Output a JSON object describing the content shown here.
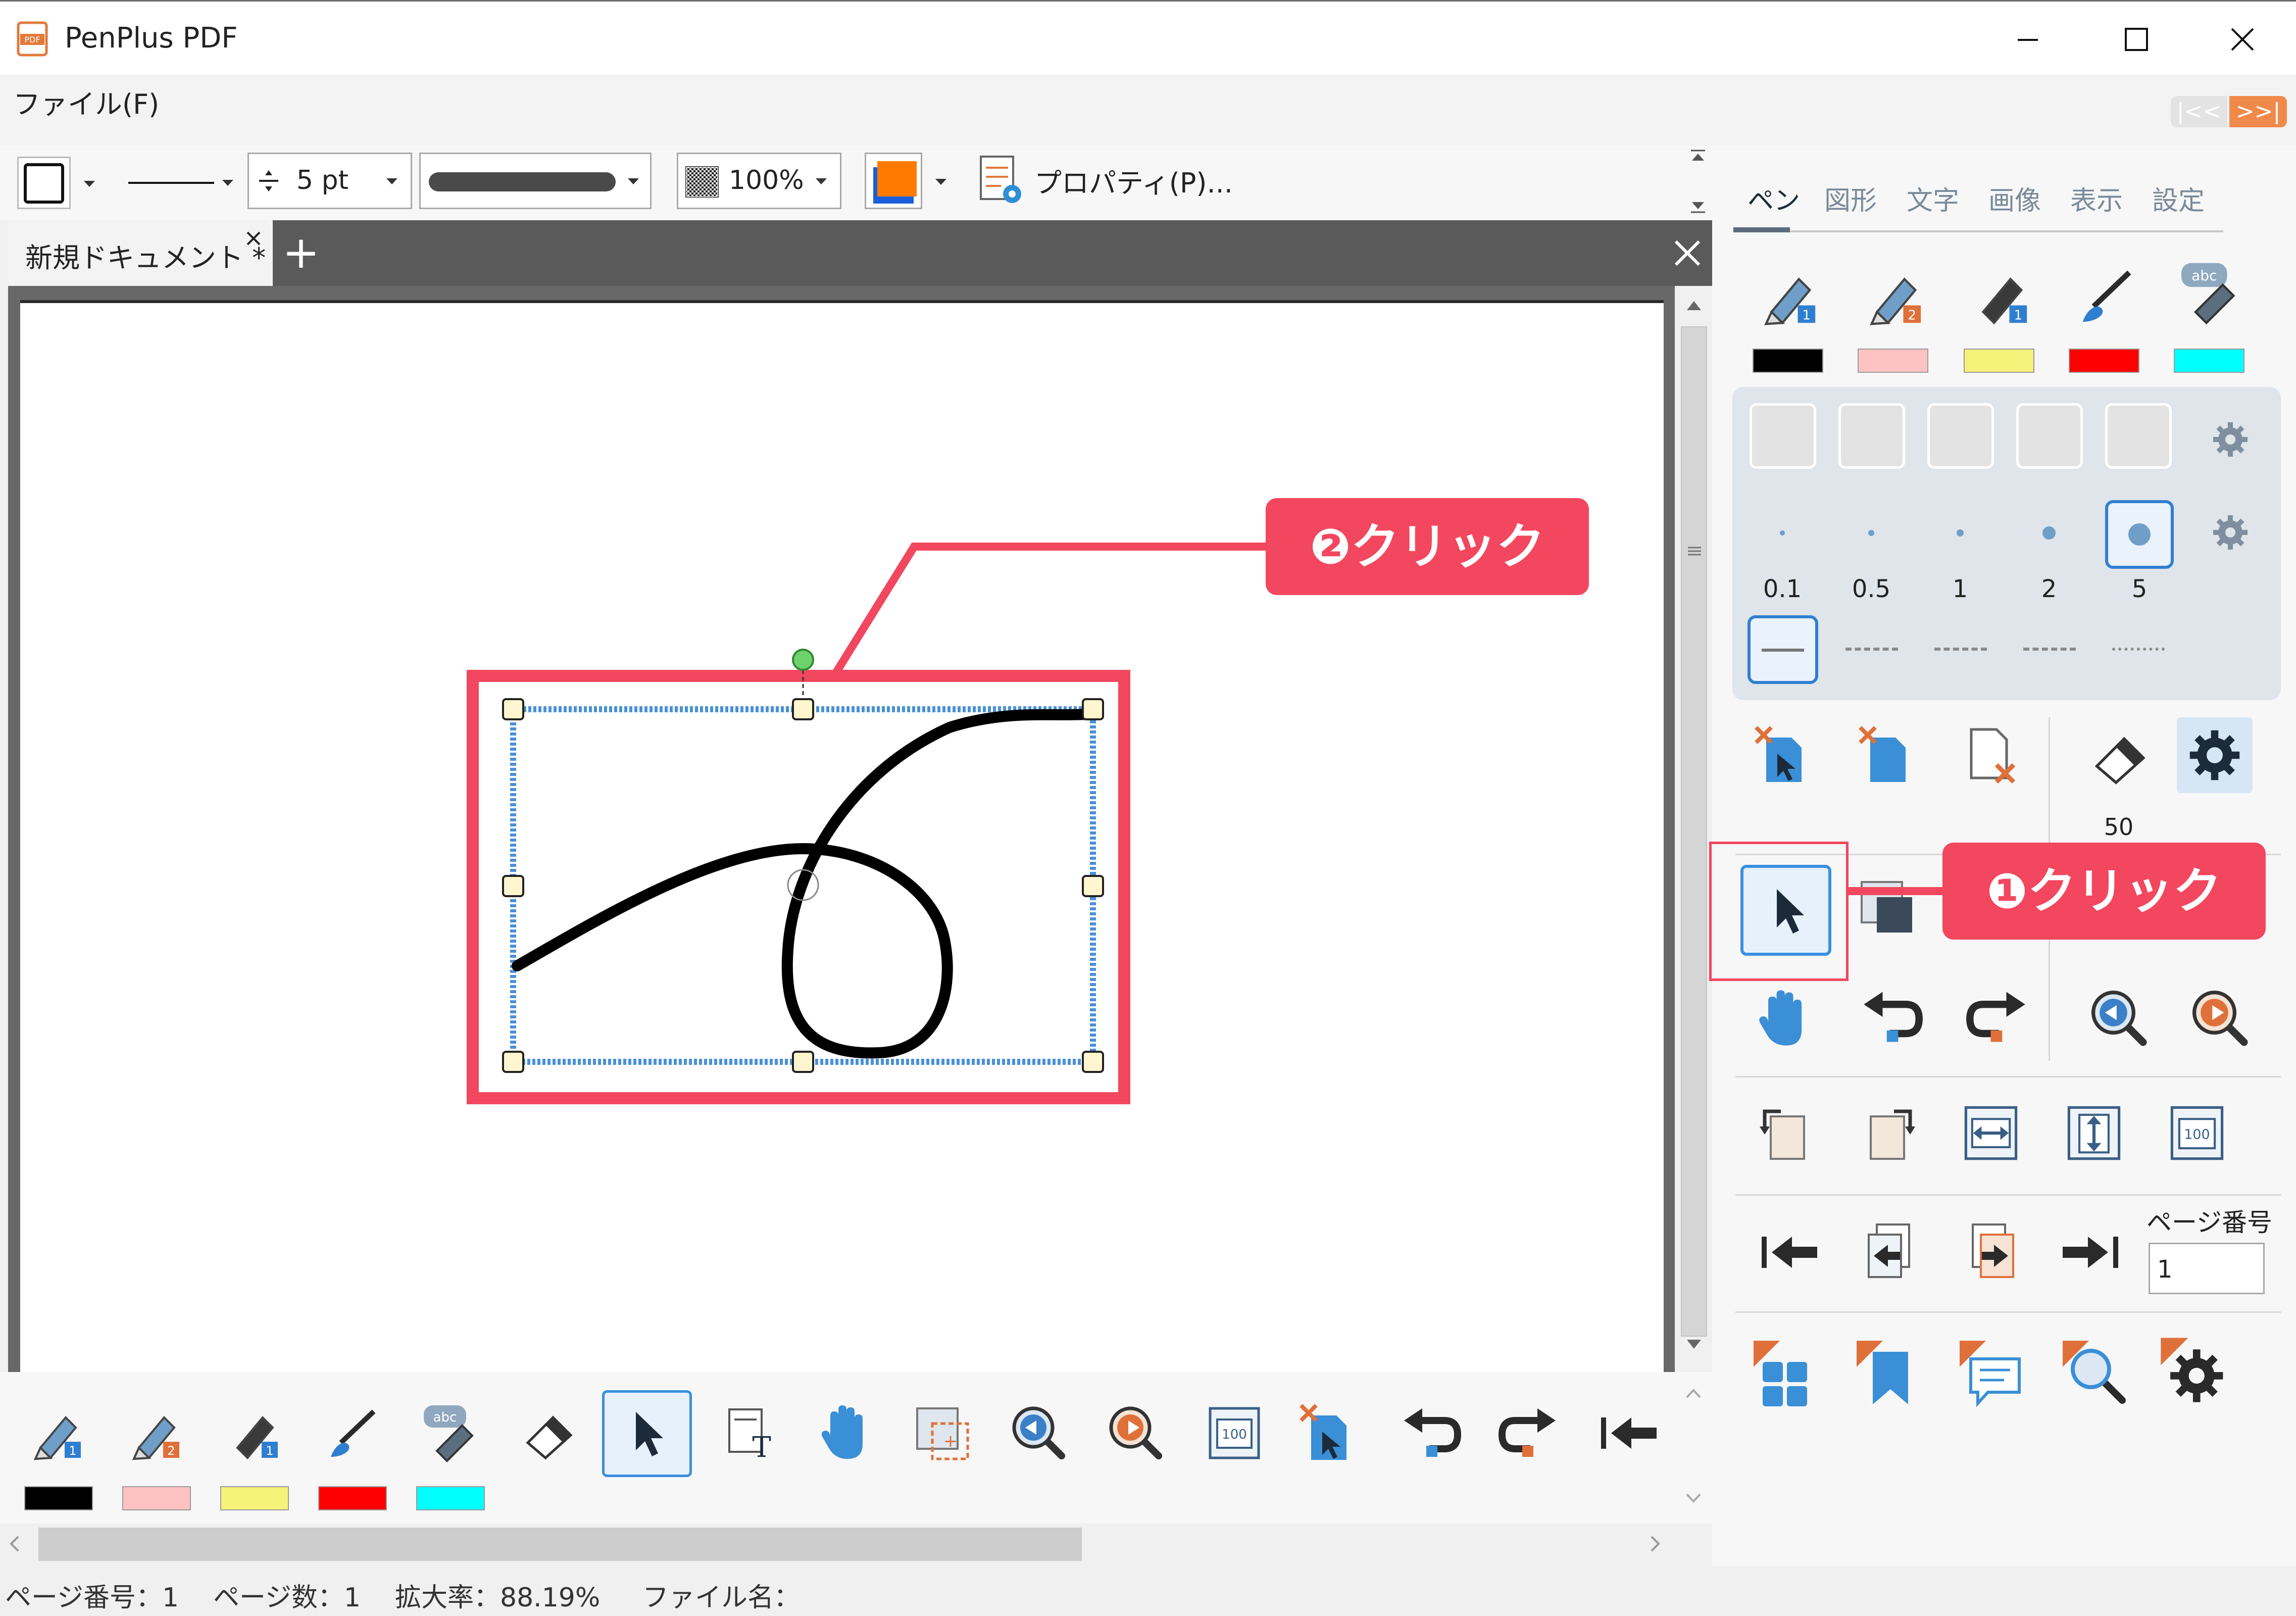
{
  "window": {
    "title": "PenPlus PDF",
    "app_icon": "pdf-icon"
  },
  "menu": {
    "file": "ファイル(F)"
  },
  "toolbar": {
    "line_width": "5 pt",
    "opacity": "100%",
    "properties": "プロパティ(P)...",
    "color_accent": "#ff7a00"
  },
  "document_tab": {
    "name": "新規ドキュメント *",
    "add": "+"
  },
  "panel": {
    "tabs": [
      "ペン",
      "図形",
      "文字",
      "画像",
      "表示",
      "設定"
    ],
    "pen_swatches": [
      "#000000",
      "#ffc2c2",
      "#f6f27a",
      "#ff0000",
      "#00ffff"
    ],
    "widths": [
      "0.1",
      "0.5",
      "1",
      "2",
      "5"
    ],
    "eraser_size": "50",
    "page_number_label": "ページ番号",
    "page_number_value": "1"
  },
  "callouts": {
    "first": "❶クリック",
    "second": "❷クリック"
  },
  "status": {
    "page_number": "ページ番号：1",
    "page_count": "ページ数：1",
    "zoom": "拡大率：88.19%",
    "file_name": "ファイル名："
  }
}
